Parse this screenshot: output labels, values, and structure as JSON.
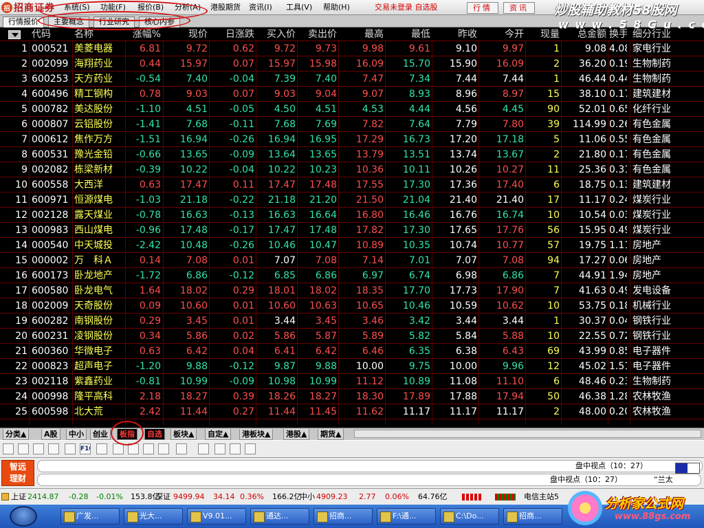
{
  "app": {
    "name": "招商证券",
    "logo_badge": "招"
  },
  "menu": [
    {
      "label": "系统(S)"
    },
    {
      "label": "功能(F)"
    },
    {
      "label": "报价(B)"
    },
    {
      "label": "分析(A)"
    },
    {
      "label": "港股期货"
    },
    {
      "label": "资讯(I)"
    },
    {
      "label": "工具(V)"
    },
    {
      "label": "帮助(H)"
    }
  ],
  "login_status": "交易未登录 自选股",
  "top_buttons": [
    "行情",
    "资讯"
  ],
  "watermark_top": {
    "title": "炒股辅助教材58股网",
    "url": "w w w . 5 8 G u . c o m"
  },
  "tabs": [
    "行情报价",
    "主要概念",
    "行业研究",
    "核心内参"
  ],
  "columns": [
    "",
    "代码",
    "名称",
    "涨幅%",
    "现价",
    "日涨跌",
    "买入价",
    "卖出价",
    "最高",
    "最低",
    "昨收",
    "今开",
    "现量",
    "总金额",
    "换手%",
    "细分行业"
  ],
  "rows": [
    {
      "n": "1",
      "code": "000521",
      "name": "美菱电器",
      "pct": "6.81",
      "price": "9.72",
      "chg": "0.62",
      "bid": "9.72",
      "ask": "9.73",
      "high": "9.98",
      "low": "9.61",
      "prev": "9.10",
      "open": "9.97",
      "vol": "1",
      "amt": "9.08",
      "turn": "4.08",
      "ind": "家电行业"
    },
    {
      "n": "2",
      "code": "002099",
      "name": "海翔药业",
      "pct": "0.44",
      "price": "15.97",
      "chg": "0.07",
      "bid": "15.97",
      "ask": "15.98",
      "high": "16.09",
      "low": "15.70",
      "prev": "15.90",
      "open": "16.09",
      "vol": "2",
      "amt": "36.20",
      "turn": "0.19",
      "ind": "生物制药"
    },
    {
      "n": "3",
      "code": "600253",
      "name": "天方药业",
      "pct": "-0.54",
      "price": "7.40",
      "chg": "-0.04",
      "bid": "7.39",
      "ask": "7.40",
      "high": "7.47",
      "low": "7.34",
      "prev": "7.44",
      "open": "7.44",
      "vol": "1",
      "amt": "46.44",
      "turn": "0.44",
      "ind": "生物制药"
    },
    {
      "n": "4",
      "code": "600496",
      "name": "精工钢构",
      "pct": "0.78",
      "price": "9.03",
      "chg": "0.07",
      "bid": "9.03",
      "ask": "9.04",
      "high": "9.07",
      "low": "8.93",
      "prev": "8.96",
      "open": "8.97",
      "vol": "15",
      "amt": "38.10",
      "turn": "0.17",
      "ind": "建筑建材"
    },
    {
      "n": "5",
      "code": "000782",
      "name": "美达股份",
      "pct": "-1.10",
      "price": "4.51",
      "chg": "-0.05",
      "bid": "4.50",
      "ask": "4.51",
      "high": "4.53",
      "low": "4.44",
      "prev": "4.56",
      "open": "4.45",
      "vol": "90",
      "amt": "52.01",
      "turn": "0.65",
      "ind": "化纤行业"
    },
    {
      "n": "6",
      "code": "000807",
      "name": "云铝股份",
      "pct": "-1.41",
      "price": "7.68",
      "chg": "-0.11",
      "bid": "7.68",
      "ask": "7.69",
      "high": "7.82",
      "low": "7.64",
      "prev": "7.79",
      "open": "7.80",
      "vol": "39",
      "amt": "114.99",
      "turn": "0.26",
      "ind": "有色金属"
    },
    {
      "n": "7",
      "code": "000612",
      "name": "焦作万方",
      "pct": "-1.51",
      "price": "16.94",
      "chg": "-0.26",
      "bid": "16.94",
      "ask": "16.95",
      "high": "17.29",
      "low": "16.73",
      "prev": "17.20",
      "open": "17.18",
      "vol": "5",
      "amt": "11.06",
      "turn": "0.55",
      "ind": "有色金属"
    },
    {
      "n": "8",
      "code": "600531",
      "name": "豫光金铅",
      "pct": "-0.66",
      "price": "13.65",
      "chg": "-0.09",
      "bid": "13.64",
      "ask": "13.65",
      "high": "13.79",
      "low": "13.51",
      "prev": "13.74",
      "open": "13.67",
      "vol": "2",
      "amt": "21.80",
      "turn": "0.17",
      "ind": "有色金属"
    },
    {
      "n": "9",
      "code": "002082",
      "name": "栋梁新材",
      "pct": "-0.39",
      "price": "10.22",
      "chg": "-0.04",
      "bid": "10.22",
      "ask": "10.23",
      "high": "10.36",
      "low": "10.11",
      "prev": "10.26",
      "open": "10.27",
      "vol": "11",
      "amt": "25.36",
      "turn": "0.31",
      "ind": "有色金属"
    },
    {
      "n": "10",
      "code": "600558",
      "name": "大西洋",
      "pct": "0.63",
      "price": "17.47",
      "chg": "0.11",
      "bid": "17.47",
      "ask": "17.48",
      "high": "17.55",
      "low": "17.30",
      "prev": "17.36",
      "open": "17.40",
      "vol": "6",
      "amt": "18.75",
      "turn": "0.13",
      "ind": "建筑建材"
    },
    {
      "n": "11",
      "code": "600971",
      "name": "恒源煤电",
      "pct": "-1.03",
      "price": "21.18",
      "chg": "-0.22",
      "bid": "21.18",
      "ask": "21.20",
      "high": "21.50",
      "low": "21.04",
      "prev": "21.40",
      "open": "21.40",
      "vol": "17",
      "amt": "11.17",
      "turn": "0.24",
      "ind": "煤炭行业"
    },
    {
      "n": "12",
      "code": "002128",
      "name": "露天煤业",
      "pct": "-0.78",
      "price": "16.63",
      "chg": "-0.13",
      "bid": "16.63",
      "ask": "16.64",
      "high": "16.80",
      "low": "16.46",
      "prev": "16.76",
      "open": "16.74",
      "vol": "10",
      "amt": "10.54",
      "turn": "0.03",
      "ind": "煤炭行业"
    },
    {
      "n": "13",
      "code": "000983",
      "name": "西山煤电",
      "pct": "-0.96",
      "price": "17.48",
      "chg": "-0.17",
      "bid": "17.47",
      "ask": "17.48",
      "high": "17.82",
      "low": "17.30",
      "prev": "17.65",
      "open": "17.76",
      "vol": "56",
      "amt": "15.95",
      "turn": "0.49",
      "ind": "煤炭行业"
    },
    {
      "n": "14",
      "code": "000540",
      "name": "中天城投",
      "pct": "-2.42",
      "price": "10.48",
      "chg": "-0.26",
      "bid": "10.46",
      "ask": "10.47",
      "high": "10.89",
      "low": "10.35",
      "prev": "10.74",
      "open": "10.77",
      "vol": "57",
      "amt": "19.75",
      "turn": "1.11",
      "ind": "房地产"
    },
    {
      "n": "15",
      "code": "000002",
      "name": "万　科Ａ",
      "pct": "0.14",
      "price": "7.08",
      "chg": "0.01",
      "bid": "7.07",
      "ask": "7.08",
      "high": "7.14",
      "low": "7.01",
      "prev": "7.07",
      "open": "7.08",
      "vol": "94",
      "amt": "17.27",
      "turn": "0.06",
      "ind": "房地产"
    },
    {
      "n": "16",
      "code": "600173",
      "name": "卧龙地产",
      "pct": "-1.72",
      "price": "6.86",
      "chg": "-0.12",
      "bid": "6.85",
      "ask": "6.86",
      "high": "6.97",
      "low": "6.74",
      "prev": "6.98",
      "open": "6.86",
      "vol": "7",
      "amt": "44.91",
      "turn": "1.94",
      "ind": "房地产"
    },
    {
      "n": "17",
      "code": "600580",
      "name": "卧龙电气",
      "pct": "1.64",
      "price": "18.02",
      "chg": "0.29",
      "bid": "18.01",
      "ask": "18.02",
      "high": "18.35",
      "low": "17.70",
      "prev": "17.73",
      "open": "17.90",
      "vol": "7",
      "amt": "41.63",
      "turn": "0.49",
      "ind": "发电设备"
    },
    {
      "n": "18",
      "code": "002009",
      "name": "天奇股份",
      "pct": "0.09",
      "price": "10.60",
      "chg": "0.01",
      "bid": "10.60",
      "ask": "10.63",
      "high": "10.65",
      "low": "10.46",
      "prev": "10.59",
      "open": "10.62",
      "vol": "10",
      "amt": "53.75",
      "turn": "0.18",
      "ind": "机械行业"
    },
    {
      "n": "19",
      "code": "600282",
      "name": "南钢股份",
      "pct": "0.29",
      "price": "3.45",
      "chg": "0.01",
      "bid": "3.44",
      "ask": "3.45",
      "high": "3.46",
      "low": "3.42",
      "prev": "3.44",
      "open": "3.44",
      "vol": "1",
      "amt": "30.37",
      "turn": "0.04",
      "ind": "钢铁行业"
    },
    {
      "n": "20",
      "code": "600231",
      "name": "凌钢股份",
      "pct": "0.34",
      "price": "5.86",
      "chg": "0.02",
      "bid": "5.86",
      "ask": "5.87",
      "high": "5.89",
      "low": "5.82",
      "prev": "5.84",
      "open": "5.88",
      "vol": "10",
      "amt": "22.55",
      "turn": "0.72",
      "ind": "钢铁行业"
    },
    {
      "n": "21",
      "code": "600360",
      "name": "华微电子",
      "pct": "0.63",
      "price": "6.42",
      "chg": "0.04",
      "bid": "6.41",
      "ask": "6.42",
      "high": "6.46",
      "low": "6.35",
      "prev": "6.38",
      "open": "6.43",
      "vol": "69",
      "amt": "43.99",
      "turn": "0.85",
      "ind": "电子器件"
    },
    {
      "n": "22",
      "code": "000823",
      "name": "超声电子",
      "pct": "-1.20",
      "price": "9.88",
      "chg": "-0.12",
      "bid": "9.87",
      "ask": "9.88",
      "high": "10.00",
      "low": "9.75",
      "prev": "10.00",
      "open": "9.96",
      "vol": "12",
      "amt": "45.02",
      "turn": "1.51",
      "ind": "电子器件"
    },
    {
      "n": "23",
      "code": "002118",
      "name": "紫鑫药业",
      "pct": "-0.81",
      "price": "10.99",
      "chg": "-0.09",
      "bid": "10.98",
      "ask": "10.99",
      "high": "11.12",
      "low": "10.89",
      "prev": "11.08",
      "open": "11.10",
      "vol": "6",
      "amt": "48.46",
      "turn": "0.23",
      "ind": "生物制药"
    },
    {
      "n": "24",
      "code": "000998",
      "name": "隆平高科",
      "pct": "2.18",
      "price": "18.27",
      "chg": "0.39",
      "bid": "18.26",
      "ask": "18.27",
      "high": "18.30",
      "low": "17.89",
      "prev": "17.88",
      "open": "17.94",
      "vol": "50",
      "amt": "46.38",
      "turn": "1.28",
      "ind": "农林牧渔"
    },
    {
      "n": "25",
      "code": "600598",
      "name": "北大荒",
      "pct": "2.42",
      "price": "11.44",
      "chg": "0.27",
      "bid": "11.44",
      "ask": "11.45",
      "high": "11.62",
      "low": "11.17",
      "prev": "11.17",
      "open": "11.17",
      "vol": "2",
      "amt": "48.00",
      "turn": "0.20",
      "ind": "农林牧渔"
    }
  ],
  "bottom_tabs": [
    "分类▲",
    "A股",
    "中小",
    "创业",
    "板指",
    "自选",
    "板块▲",
    "自定▲",
    "港板块▲",
    "港股▲",
    "期货▲"
  ],
  "toolbar_icons": [
    "table-icon",
    "grid-icon",
    "line-chart-icon",
    "candle-icon",
    "list-icon",
    "f10-icon",
    "f2-icon",
    "f3-icon",
    "f4-icon",
    "f5-icon",
    "f6-icon",
    "chart-icon",
    "folder-icon",
    "sort-icon",
    "zoom-icon",
    "exit-icon"
  ],
  "toolbar_labels": [
    "",
    "",
    "",
    "",
    "",
    "F10",
    "",
    "",
    "",
    "",
    "",
    "",
    "",
    "",
    "",
    ""
  ],
  "info_panel": {
    "badge_line1": "智远",
    "badge_line2": "理财",
    "line1": "盘中视点（10：27）",
    "line2": "盘中视点（10：27）",
    "line2_tail": "“兰太"
  },
  "status": {
    "sh": {
      "label": "上证",
      "value": "2414.87",
      "chg": "-0.28",
      "pct": "-0.01%",
      "amt": "153.8亿"
    },
    "sz": {
      "label": "深证",
      "value": "9499.94",
      "chg": "34.14",
      "pct": "0.36%",
      "amt": "166.2亿"
    },
    "zx": {
      "label": "中小",
      "value": "4909.23",
      "chg": "2.77",
      "pct": "0.06%",
      "amt": "64.76亿"
    },
    "server": "电信主站5"
  },
  "taskbar": [
    "广发...",
    "光大...",
    "V9.01...",
    "通达...",
    "招商...",
    "F:\\通...",
    "C:\\Do...",
    "招商..."
  ],
  "watermark_bottom": {
    "title": "分析家公式网",
    "url": "www.88gs.com"
  },
  "colors": {
    "up": "#ff4e4e",
    "down": "#35e3a8",
    "name": "#ffff55",
    "grid_line": "#6b0000",
    "annotation": "#d21212"
  }
}
